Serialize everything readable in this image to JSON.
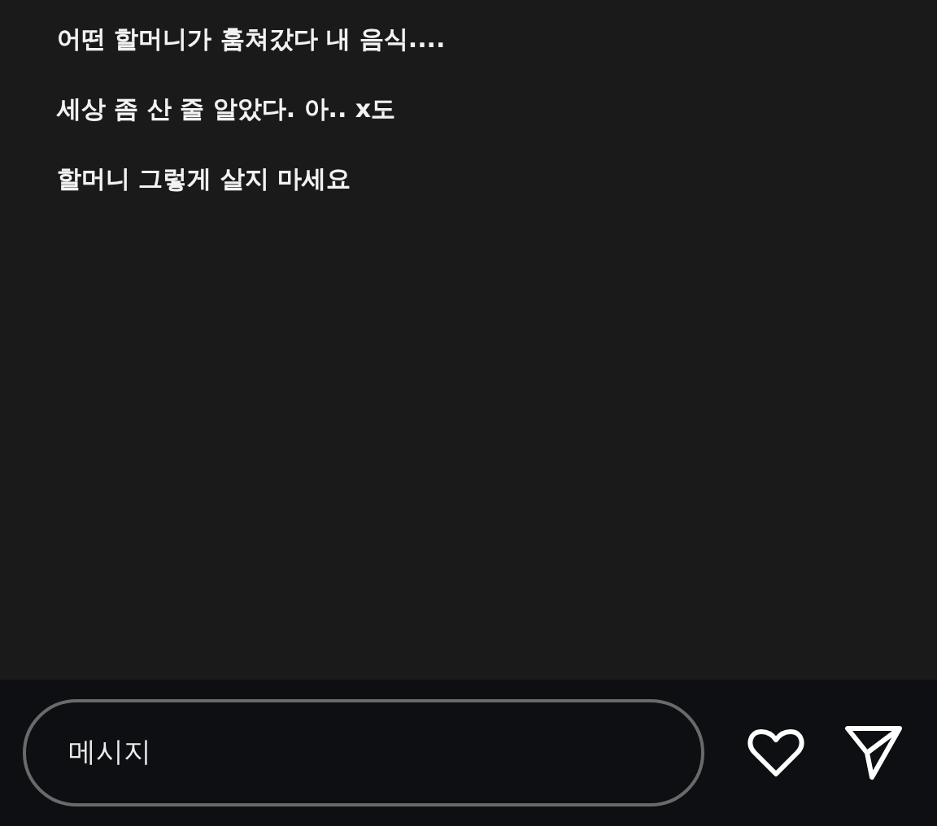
{
  "messages": [
    {
      "text": "어떤 할머니가 훔쳐갔다 내 음식...."
    },
    {
      "text": "세상 좀 산 줄 알았다. 아.. x도"
    },
    {
      "text": "할머니 그렇게 살지 마세요"
    }
  ],
  "composer": {
    "placeholder": "메시지"
  }
}
